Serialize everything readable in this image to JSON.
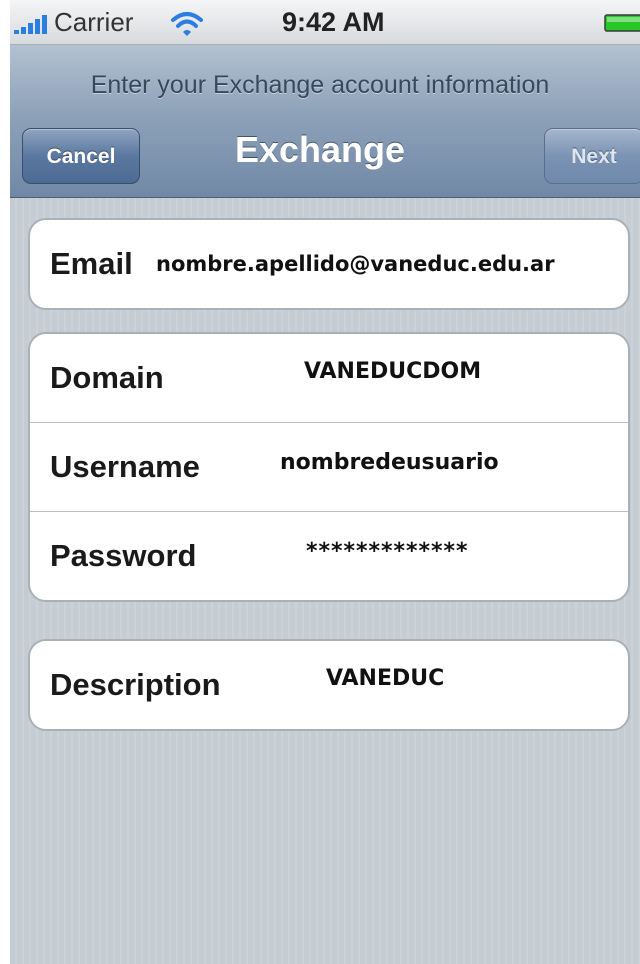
{
  "status_bar": {
    "carrier": "Carrier",
    "time": "9:42 AM",
    "icons": [
      "signal-bars-icon",
      "wifi-icon",
      "battery-icon"
    ],
    "battery_color": "#28c628"
  },
  "navbar": {
    "prompt": "Enter your Exchange account information",
    "title": "Exchange",
    "cancel_label": "Cancel",
    "next_label": "Next"
  },
  "form": {
    "email": {
      "label": "Email",
      "value": "nombre.apellido@vaneduc.edu.ar"
    },
    "domain": {
      "label": "Domain",
      "value": "VANEDUCDOM"
    },
    "username": {
      "label": "Username",
      "value": "nombredeusuario"
    },
    "password": {
      "label": "Password",
      "value": "*************"
    },
    "description": {
      "label": "Description",
      "value": "VANEDUC"
    }
  },
  "colors": {
    "nav_gradient_top": "#b3c1d2",
    "nav_gradient_bottom": "#7088a6",
    "background": "#c5ccd4"
  }
}
